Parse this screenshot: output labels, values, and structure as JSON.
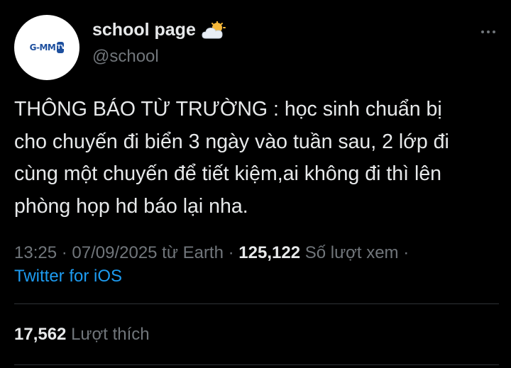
{
  "tweet": {
    "author": {
      "display_name": "school page",
      "name_emoji_icon": "sun-behind-cloud-icon",
      "handle": "@school",
      "avatar_logo_text": "G-MM",
      "avatar_logo_mark": "TV"
    },
    "text": "THÔNG BÁO TỪ TRƯỜNG : học sinh chuẩn bị\ncho chuyến đi biển 3 ngày vào tuần sau, 2 lớp đi\ncùng một chuyến để tiết kiệm,ai không đi thì lên\nphòng họp hd báo lại nha.",
    "meta": {
      "time": "13:25",
      "separator": " · ",
      "date": "07/09/2025",
      "location": " từ Earth",
      "views_count": "125,122",
      "views_label": " Số lượt xem",
      "trailing": " ·"
    },
    "source": "Twitter for iOS",
    "likes": {
      "count": "17,562",
      "label": " Lượt thích"
    }
  },
  "colors": {
    "background": "#000000",
    "primary_text": "#e7e9ea",
    "secondary_text": "#71767b",
    "link": "#1d9bf0",
    "divider": "#2f3336"
  }
}
